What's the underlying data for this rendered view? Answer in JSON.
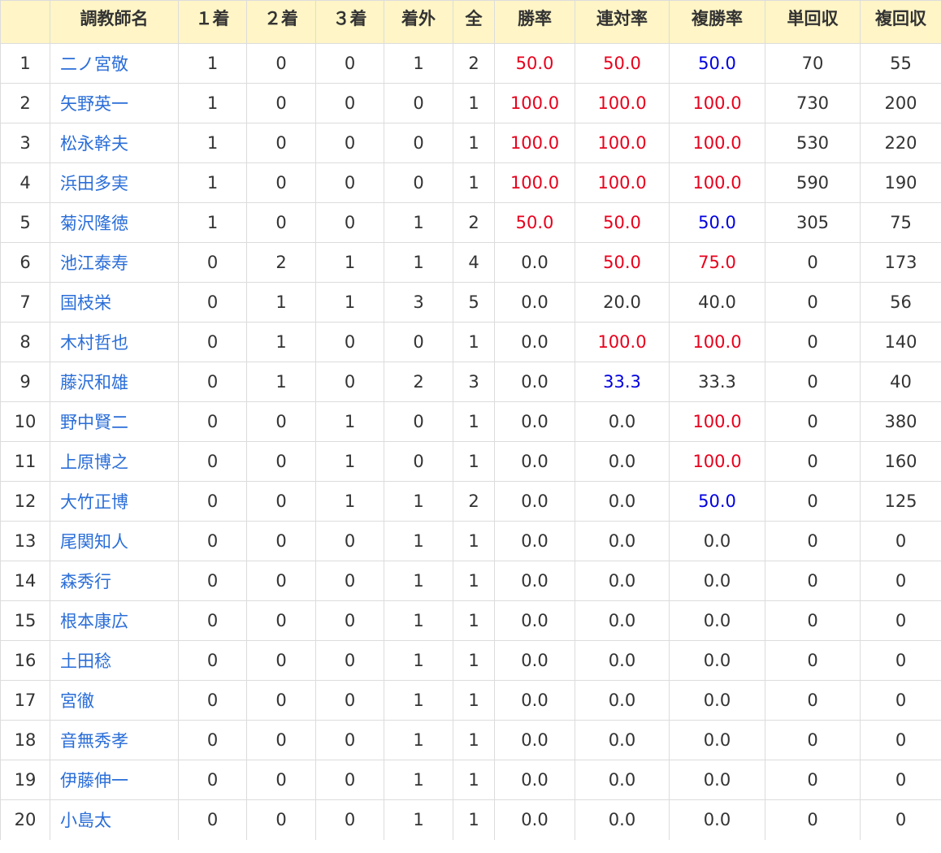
{
  "colors": {
    "header_bg": "#fff5c6",
    "link": "#2a6ed8",
    "rate_high": "#e8001c",
    "rate_mid": "#0000e0",
    "border": "#dcdcdc"
  },
  "columns": [
    "",
    "調教師名",
    "１着",
    "２着",
    "３着",
    "着外",
    "全",
    "勝率",
    "連対率",
    "複勝率",
    "単回収",
    "複回収"
  ],
  "rows": [
    {
      "rank": "1",
      "name": "二ノ宮敬",
      "first": "1",
      "second": "0",
      "third": "0",
      "out": "1",
      "total": "2",
      "win_rate": "50.0",
      "win_color": "red",
      "quinella_rate": "50.0",
      "quinella_color": "red",
      "show_rate": "50.0",
      "show_color": "blue",
      "win_return": "70",
      "show_return": "55"
    },
    {
      "rank": "2",
      "name": "矢野英一",
      "first": "1",
      "second": "0",
      "third": "0",
      "out": "0",
      "total": "1",
      "win_rate": "100.0",
      "win_color": "red",
      "quinella_rate": "100.0",
      "quinella_color": "red",
      "show_rate": "100.0",
      "show_color": "red",
      "win_return": "730",
      "show_return": "200"
    },
    {
      "rank": "3",
      "name": "松永幹夫",
      "first": "1",
      "second": "0",
      "third": "0",
      "out": "0",
      "total": "1",
      "win_rate": "100.0",
      "win_color": "red",
      "quinella_rate": "100.0",
      "quinella_color": "red",
      "show_rate": "100.0",
      "show_color": "red",
      "win_return": "530",
      "show_return": "220"
    },
    {
      "rank": "4",
      "name": "浜田多実",
      "first": "1",
      "second": "0",
      "third": "0",
      "out": "0",
      "total": "1",
      "win_rate": "100.0",
      "win_color": "red",
      "quinella_rate": "100.0",
      "quinella_color": "red",
      "show_rate": "100.0",
      "show_color": "red",
      "win_return": "590",
      "show_return": "190"
    },
    {
      "rank": "5",
      "name": "菊沢隆徳",
      "first": "1",
      "second": "0",
      "third": "0",
      "out": "1",
      "total": "2",
      "win_rate": "50.0",
      "win_color": "red",
      "quinella_rate": "50.0",
      "quinella_color": "red",
      "show_rate": "50.0",
      "show_color": "blue",
      "win_return": "305",
      "show_return": "75"
    },
    {
      "rank": "6",
      "name": "池江泰寿",
      "first": "0",
      "second": "2",
      "third": "1",
      "out": "1",
      "total": "4",
      "win_rate": "0.0",
      "win_color": "",
      "quinella_rate": "50.0",
      "quinella_color": "red",
      "show_rate": "75.0",
      "show_color": "red",
      "win_return": "0",
      "show_return": "173"
    },
    {
      "rank": "7",
      "name": "国枝栄",
      "first": "0",
      "second": "1",
      "third": "1",
      "out": "3",
      "total": "5",
      "win_rate": "0.0",
      "win_color": "",
      "quinella_rate": "20.0",
      "quinella_color": "",
      "show_rate": "40.0",
      "show_color": "",
      "win_return": "0",
      "show_return": "56"
    },
    {
      "rank": "8",
      "name": "木村哲也",
      "first": "0",
      "second": "1",
      "third": "0",
      "out": "0",
      "total": "1",
      "win_rate": "0.0",
      "win_color": "",
      "quinella_rate": "100.0",
      "quinella_color": "red",
      "show_rate": "100.0",
      "show_color": "red",
      "win_return": "0",
      "show_return": "140"
    },
    {
      "rank": "9",
      "name": "藤沢和雄",
      "first": "0",
      "second": "1",
      "third": "0",
      "out": "2",
      "total": "3",
      "win_rate": "0.0",
      "win_color": "",
      "quinella_rate": "33.3",
      "quinella_color": "blue",
      "show_rate": "33.3",
      "show_color": "",
      "win_return": "0",
      "show_return": "40"
    },
    {
      "rank": "10",
      "name": "野中賢二",
      "first": "0",
      "second": "0",
      "third": "1",
      "out": "0",
      "total": "1",
      "win_rate": "0.0",
      "win_color": "",
      "quinella_rate": "0.0",
      "quinella_color": "",
      "show_rate": "100.0",
      "show_color": "red",
      "win_return": "0",
      "show_return": "380"
    },
    {
      "rank": "11",
      "name": "上原博之",
      "first": "0",
      "second": "0",
      "third": "1",
      "out": "0",
      "total": "1",
      "win_rate": "0.0",
      "win_color": "",
      "quinella_rate": "0.0",
      "quinella_color": "",
      "show_rate": "100.0",
      "show_color": "red",
      "win_return": "0",
      "show_return": "160"
    },
    {
      "rank": "12",
      "name": "大竹正博",
      "first": "0",
      "second": "0",
      "third": "1",
      "out": "1",
      "total": "2",
      "win_rate": "0.0",
      "win_color": "",
      "quinella_rate": "0.0",
      "quinella_color": "",
      "show_rate": "50.0",
      "show_color": "blue",
      "win_return": "0",
      "show_return": "125"
    },
    {
      "rank": "13",
      "name": "尾関知人",
      "first": "0",
      "second": "0",
      "third": "0",
      "out": "1",
      "total": "1",
      "win_rate": "0.0",
      "win_color": "",
      "quinella_rate": "0.0",
      "quinella_color": "",
      "show_rate": "0.0",
      "show_color": "",
      "win_return": "0",
      "show_return": "0"
    },
    {
      "rank": "14",
      "name": "森秀行",
      "first": "0",
      "second": "0",
      "third": "0",
      "out": "1",
      "total": "1",
      "win_rate": "0.0",
      "win_color": "",
      "quinella_rate": "0.0",
      "quinella_color": "",
      "show_rate": "0.0",
      "show_color": "",
      "win_return": "0",
      "show_return": "0"
    },
    {
      "rank": "15",
      "name": "根本康広",
      "first": "0",
      "second": "0",
      "third": "0",
      "out": "1",
      "total": "1",
      "win_rate": "0.0",
      "win_color": "",
      "quinella_rate": "0.0",
      "quinella_color": "",
      "show_rate": "0.0",
      "show_color": "",
      "win_return": "0",
      "show_return": "0"
    },
    {
      "rank": "16",
      "name": "土田稔",
      "first": "0",
      "second": "0",
      "third": "0",
      "out": "1",
      "total": "1",
      "win_rate": "0.0",
      "win_color": "",
      "quinella_rate": "0.0",
      "quinella_color": "",
      "show_rate": "0.0",
      "show_color": "",
      "win_return": "0",
      "show_return": "0"
    },
    {
      "rank": "17",
      "name": "宮徹",
      "first": "0",
      "second": "0",
      "third": "0",
      "out": "1",
      "total": "1",
      "win_rate": "0.0",
      "win_color": "",
      "quinella_rate": "0.0",
      "quinella_color": "",
      "show_rate": "0.0",
      "show_color": "",
      "win_return": "0",
      "show_return": "0"
    },
    {
      "rank": "18",
      "name": "音無秀孝",
      "first": "0",
      "second": "0",
      "third": "0",
      "out": "1",
      "total": "1",
      "win_rate": "0.0",
      "win_color": "",
      "quinella_rate": "0.0",
      "quinella_color": "",
      "show_rate": "0.0",
      "show_color": "",
      "win_return": "0",
      "show_return": "0"
    },
    {
      "rank": "19",
      "name": "伊藤伸一",
      "first": "0",
      "second": "0",
      "third": "0",
      "out": "1",
      "total": "1",
      "win_rate": "0.0",
      "win_color": "",
      "quinella_rate": "0.0",
      "quinella_color": "",
      "show_rate": "0.0",
      "show_color": "",
      "win_return": "0",
      "show_return": "0"
    },
    {
      "rank": "20",
      "name": "小島太",
      "first": "0",
      "second": "0",
      "third": "0",
      "out": "1",
      "total": "1",
      "win_rate": "0.0",
      "win_color": "",
      "quinella_rate": "0.0",
      "quinella_color": "",
      "show_rate": "0.0",
      "show_color": "",
      "win_return": "0",
      "show_return": "0"
    }
  ]
}
